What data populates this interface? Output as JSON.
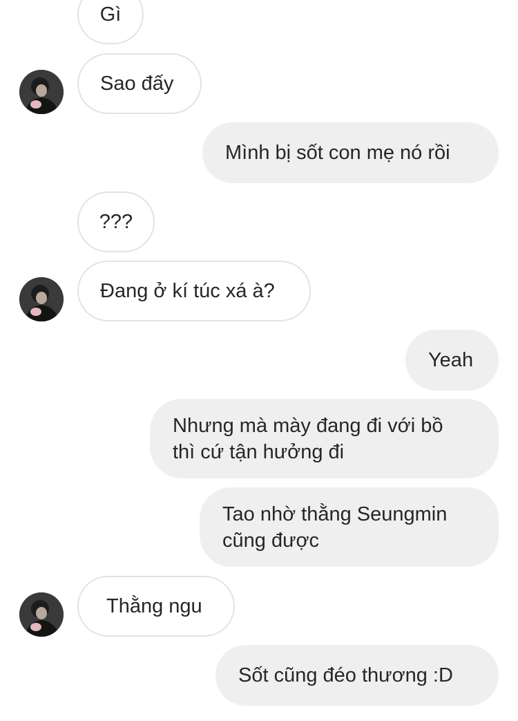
{
  "messages": [
    {
      "id": "m1",
      "sender": "them",
      "text": "Gì"
    },
    {
      "id": "m2",
      "sender": "them",
      "text": "Sao đấy"
    },
    {
      "id": "m3",
      "sender": "me",
      "text": "Mình bị sốt con mẹ nó rồi"
    },
    {
      "id": "m4",
      "sender": "them",
      "text": "???"
    },
    {
      "id": "m5",
      "sender": "them",
      "text": "Đang ở kí túc xá à?"
    },
    {
      "id": "m6",
      "sender": "me",
      "text": "Yeah"
    },
    {
      "id": "m7",
      "sender": "me",
      "lines": [
        "Nhưng mà mày đang đi với bồ",
        "thì cứ tận hưởng đi"
      ]
    },
    {
      "id": "m8",
      "sender": "me",
      "lines": [
        "Tao nhờ thằng Seungmin",
        "cũng được"
      ]
    },
    {
      "id": "m9",
      "sender": "them",
      "text": "Thằng ngu"
    },
    {
      "id": "m10",
      "sender": "me",
      "text": "Sốt cũng đéo thương :D"
    }
  ],
  "colors": {
    "incoming_bubble_bg": "#ffffff",
    "incoming_bubble_border": "#e3e3e3",
    "outgoing_bubble_bg": "#efefef",
    "text": "#262626"
  },
  "avatar": {
    "icon": "profile-photo"
  }
}
